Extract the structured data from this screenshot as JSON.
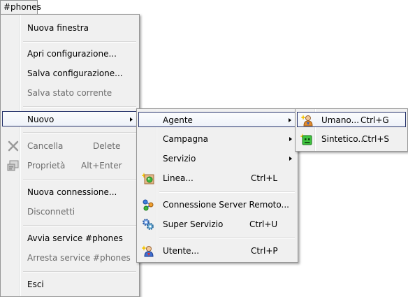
{
  "menubar": {
    "label": "#phones"
  },
  "main_menu": {
    "items": [
      {
        "label": "Nuova finestra"
      },
      {
        "label": "Apri configurazione..."
      },
      {
        "label": "Salva configurazione..."
      },
      {
        "label": "Salva stato corrente",
        "disabled": true
      },
      {
        "label": "Nuovo"
      },
      {
        "label": "Cancella",
        "shortcut": "Delete",
        "disabled": true,
        "icon": "delete-x-icon"
      },
      {
        "label": "Proprietà",
        "shortcut": "Alt+Enter",
        "disabled": true,
        "icon": "properties-icon"
      },
      {
        "label": "Nuova connessione..."
      },
      {
        "label": "Disconnetti",
        "disabled": true
      },
      {
        "label": "Avvia service #phones"
      },
      {
        "label": "Arresta service #phones",
        "disabled": true
      },
      {
        "label": "Esci"
      }
    ]
  },
  "submenu_nuovo": {
    "items": [
      {
        "label": "Agente"
      },
      {
        "label": "Campagna"
      },
      {
        "label": "Servizio"
      },
      {
        "label": "Linea...",
        "shortcut": "Ctrl+L",
        "icon": "new-line-icon"
      },
      {
        "label": "Connessione Server Remoto...",
        "icon": "remote-server-icon"
      },
      {
        "label": "Super Servizio",
        "shortcut": "Ctrl+U",
        "icon": "super-service-icon"
      },
      {
        "label": "Utente...",
        "shortcut": "Ctrl+P",
        "icon": "new-user-icon"
      }
    ]
  },
  "submenu_agente": {
    "items": [
      {
        "label": "Umano...",
        "shortcut": "Ctrl+G",
        "icon": "human-agent-icon"
      },
      {
        "label": "Sintetico...",
        "shortcut": "Ctrl+S",
        "icon": "synthetic-agent-icon"
      }
    ]
  }
}
